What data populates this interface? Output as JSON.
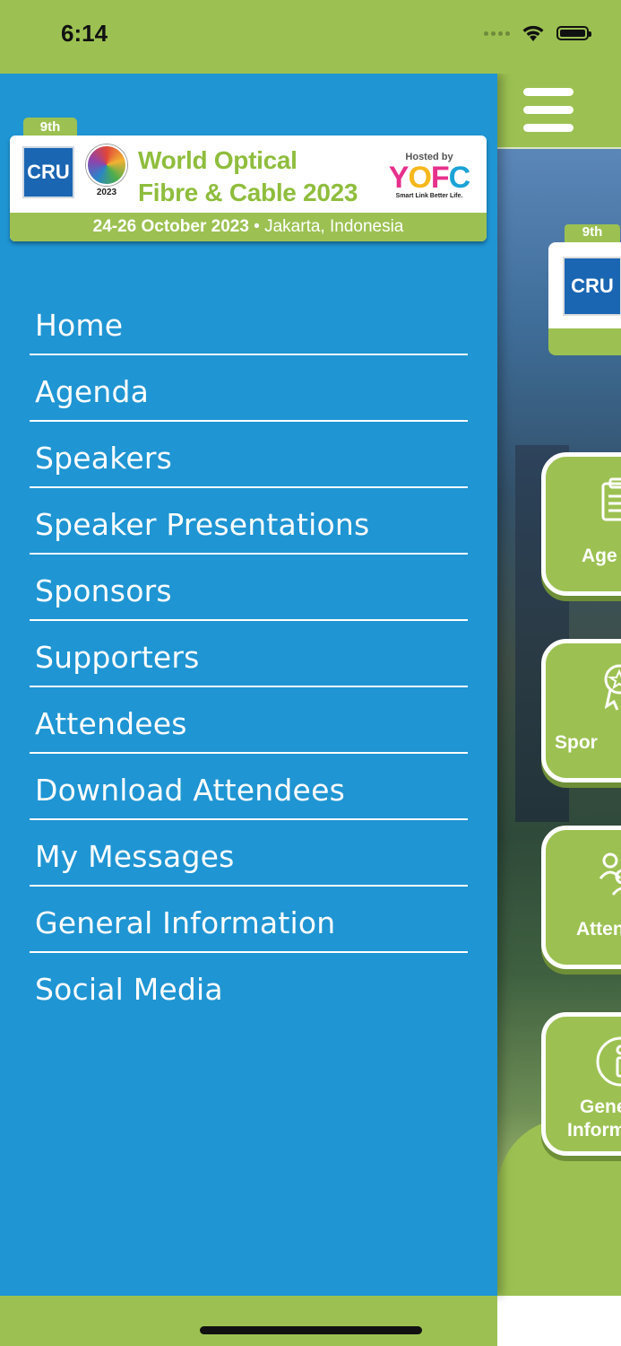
{
  "status_bar": {
    "time": "6:14",
    "icons": [
      "signal-dots",
      "wifi-icon",
      "battery-icon"
    ]
  },
  "drawer": {
    "logo": {
      "edition": "9th",
      "cru": "CRU",
      "globe_year": "2023",
      "title_line1": "World Optical",
      "title_line2": "Fibre & Cable 2023",
      "hosted_by": "Hosted by",
      "host": {
        "y": "Y",
        "o": "O",
        "f": "F",
        "c": "C"
      },
      "host_tagline": "Smart Link Better Life.",
      "date": "24-26 October 2023",
      "separator": "•",
      "location": "Jakarta, Indonesia"
    },
    "menu": [
      {
        "label": "Home"
      },
      {
        "label": "Agenda"
      },
      {
        "label": "Speakers"
      },
      {
        "label": "Speaker Presentations"
      },
      {
        "label": "Sponsors"
      },
      {
        "label": "Supporters"
      },
      {
        "label": "Attendees"
      },
      {
        "label": "Download Attendees"
      },
      {
        "label": "My Messages"
      },
      {
        "label": "General Information"
      },
      {
        "label": "Social Media"
      }
    ]
  },
  "background_app": {
    "menu_icon": "hamburger-icon",
    "banner_edition": "9th",
    "banner_cru": "CRU",
    "tiles": [
      {
        "label": "Age",
        "icon": "clipboard-icon"
      },
      {
        "label": "Spor",
        "icon": "star-badge-icon"
      },
      {
        "label": "Atten",
        "icon": "people-icon"
      },
      {
        "label1": "Gene",
        "label2": "Inform",
        "icon": "info-icon"
      }
    ]
  },
  "colors": {
    "drawer_bg": "#1f95d3",
    "brand_green": "#9cc152",
    "text": "#ffffff"
  }
}
